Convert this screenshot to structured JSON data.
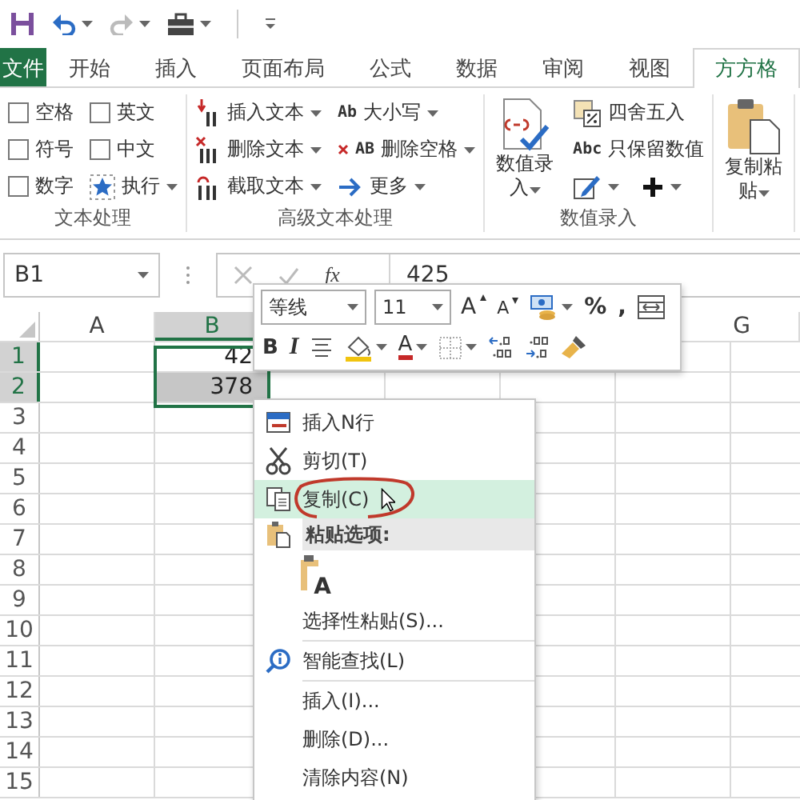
{
  "tabs": [
    {
      "kind": "file",
      "label": "文件",
      "selected": false
    },
    {
      "kind": "tab",
      "label": "开始",
      "selected": false
    },
    {
      "kind": "tab",
      "label": "插入",
      "selected": false
    },
    {
      "kind": "tab",
      "label": "页面布局",
      "selected": false
    },
    {
      "kind": "tab",
      "label": "公式",
      "selected": false
    },
    {
      "kind": "tab",
      "label": "数据",
      "selected": false
    },
    {
      "kind": "tab",
      "label": "审阅",
      "selected": false
    },
    {
      "kind": "tab",
      "label": "视图",
      "selected": false
    },
    {
      "kind": "tab",
      "label": "方方格",
      "selected": true
    }
  ],
  "ribbon": {
    "groups": [
      {
        "label": "文本处理",
        "columns": [
          [
            {
              "kind": "checkbox",
              "label": "空格",
              "checked": false
            },
            {
              "kind": "checkbox",
              "label": "符号",
              "checked": false
            },
            {
              "kind": "checkbox",
              "label": "数字",
              "checked": false
            }
          ],
          [
            {
              "kind": "checkbox",
              "label": "英文",
              "checked": false
            },
            {
              "kind": "checkbox",
              "label": "中文",
              "checked": false
            },
            {
              "kind": "menu",
              "label": "执行"
            }
          ]
        ]
      },
      {
        "label": "高级文本处理",
        "columns": [
          [
            {
              "kind": "menu",
              "label": "插入文本"
            },
            {
              "kind": "menu",
              "label": "删除文本"
            },
            {
              "kind": "menu",
              "label": "截取文本"
            }
          ],
          [
            {
              "kind": "menu",
              "icon_text": "Ab",
              "label": "大小写"
            },
            {
              "kind": "menu",
              "icon_text": "AB",
              "label": "删除空格"
            },
            {
              "kind": "menu",
              "label": "更多"
            }
          ]
        ]
      },
      {
        "label": "数值录入",
        "columns": [
          [
            {
              "kind": "large",
              "label": "数值录入"
            }
          ],
          [
            {
              "kind": "small",
              "label": "四舍五入"
            },
            {
              "kind": "small",
              "icon_text": "Abc",
              "label": "只保留数值"
            },
            {
              "kind": "icon_row",
              "items": [
                {
                  "kind": "icon_menu"
                },
                {
                  "kind": "icon_menu"
                }
              ]
            }
          ]
        ]
      },
      {
        "columns": [
          [
            {
              "kind": "large",
              "label": "复制粘贴"
            }
          ]
        ]
      }
    ]
  },
  "formula_bar": {
    "name_box": "B1",
    "function_label": "fx",
    "value": "425"
  },
  "sheet": {
    "columns": [
      {
        "label": "A",
        "selected": false
      },
      {
        "label": "B",
        "selected": true
      },
      {
        "label": "G",
        "selected": false
      }
    ],
    "rows": [
      {
        "number": "1",
        "selected": true,
        "column_b": "42",
        "column_b_selected": false
      },
      {
        "number": "2",
        "selected": true,
        "column_b": "378",
        "column_b_selected": true
      },
      {
        "number": "3",
        "selected": false
      },
      {
        "number": "4",
        "selected": false
      },
      {
        "number": "5",
        "selected": false
      },
      {
        "number": "6",
        "selected": false
      },
      {
        "number": "7",
        "selected": false
      },
      {
        "number": "8",
        "selected": false
      },
      {
        "number": "9",
        "selected": false
      },
      {
        "number": "10",
        "selected": false
      },
      {
        "number": "11",
        "selected": false
      },
      {
        "number": "12",
        "selected": false
      },
      {
        "number": "13",
        "selected": false
      },
      {
        "number": "14",
        "selected": false
      },
      {
        "number": "15",
        "selected": false
      }
    ]
  },
  "mini_toolbar": {
    "top_row": [
      {
        "kind": "font_field",
        "value": "等线"
      },
      {
        "kind": "size_field",
        "value": "11"
      },
      {
        "kind": "grow_font",
        "label": "A"
      },
      {
        "kind": "shrink_font",
        "label": "A"
      },
      {
        "kind": "accounting"
      },
      {
        "kind": "text",
        "label": "%"
      },
      {
        "kind": "text",
        "label": ","
      },
      {
        "kind": "wrap"
      }
    ],
    "bottom_row": [
      {
        "kind": "bold",
        "label": "B"
      },
      {
        "kind": "italic",
        "label": "I"
      },
      {
        "kind": "align"
      },
      {
        "kind": "fill"
      },
      {
        "kind": "font_color",
        "label": "A"
      },
      {
        "kind": "borders"
      },
      {
        "kind": "increase_decimal"
      },
      {
        "kind": "decrease_decimal"
      },
      {
        "kind": "painter"
      }
    ]
  },
  "context_menu": {
    "items": [
      {
        "kind": "item",
        "label": "插入N行",
        "selected": false
      },
      {
        "kind": "item",
        "label": "剪切(T)",
        "selected": false
      },
      {
        "kind": "item",
        "label": "复制(C)",
        "selected": true
      },
      {
        "kind": "header",
        "label": "粘贴选项:"
      },
      {
        "kind": "paste_option",
        "label": "A",
        "selected": false
      },
      {
        "kind": "item",
        "label": "选择性粘贴(S)...",
        "selected": false
      },
      {
        "kind": "separator"
      },
      {
        "kind": "item",
        "label": "智能查找(L)",
        "selected": false
      },
      {
        "kind": "separator"
      },
      {
        "kind": "item",
        "label": "插入(I)...",
        "selected": false
      },
      {
        "kind": "item",
        "label": "删除(D)...",
        "selected": false
      },
      {
        "kind": "item",
        "label": "清除内容(N)",
        "selected": false
      }
    ]
  }
}
